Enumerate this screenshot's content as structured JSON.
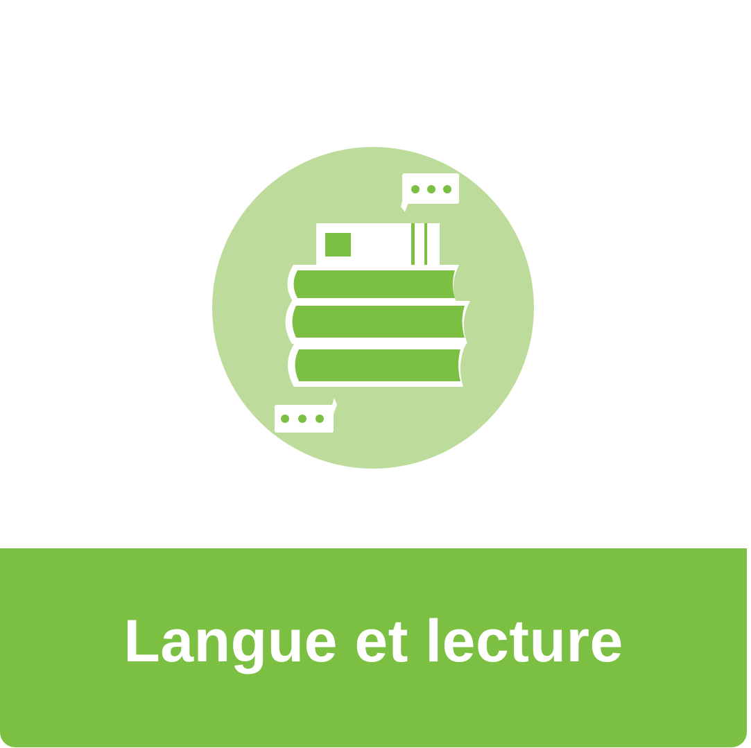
{
  "colors": {
    "accent": "#7bc043",
    "circle": "#bddc9c",
    "white": "#ffffff"
  },
  "illustration": {
    "icon": "books-with-speech-bubbles-icon"
  },
  "banner": {
    "title": "Langue et lecture"
  }
}
